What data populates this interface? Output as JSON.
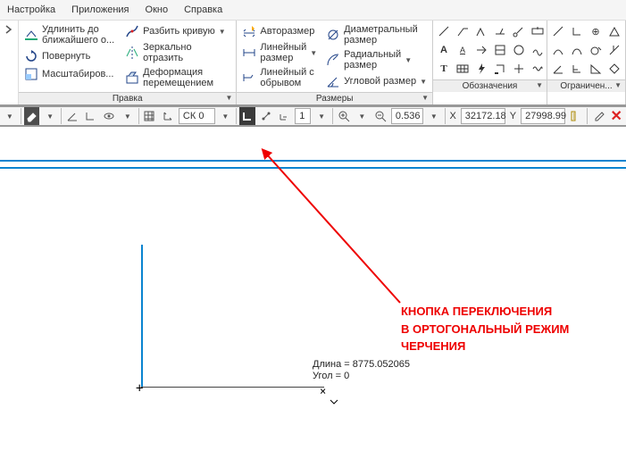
{
  "menu": {
    "items": [
      "Настройка",
      "Приложения",
      "Окно",
      "Справка"
    ]
  },
  "ribbon": {
    "edit": {
      "caption": "Правка",
      "items": [
        {
          "label": "Удлинить до\nближайшего о..."
        },
        {
          "label": "Повернуть"
        },
        {
          "label": "Масштабиров..."
        }
      ],
      "col2": [
        {
          "label": "Разбить кривую"
        },
        {
          "label": "Зеркально\nотразить"
        },
        {
          "label": "Деформация\nперемещением"
        }
      ]
    },
    "dims": {
      "caption": "Размеры",
      "col1": [
        {
          "label": "Авторазмер"
        },
        {
          "label": "Линейный\nразмер"
        },
        {
          "label": "Линейный с\nобрывом"
        }
      ],
      "col2": [
        {
          "label": "Диаметральный\nразмер"
        },
        {
          "label": "Радиальный\nразмер"
        },
        {
          "label": "Угловой размер"
        }
      ]
    },
    "annot_caption": "Обозначения",
    "constr_caption": "Ограничен..."
  },
  "strip": {
    "ck_label": "СК 0",
    "num_label": "1",
    "zoom": "0.536",
    "x_label": "X",
    "x_val": "32172.18",
    "y_label": "Y",
    "y_val": "27998.99"
  },
  "canvas": {
    "length": "Длина = 8775.052065",
    "angle": "Угол = 0"
  },
  "annotation": {
    "line1": "КНОПКА ПЕРЕКЛЮЧЕНИЯ",
    "line2": "В ОРТОГОНАЛЬНЫЙ РЕЖИМ",
    "line3": "ЧЕРЧЕНИЯ"
  }
}
